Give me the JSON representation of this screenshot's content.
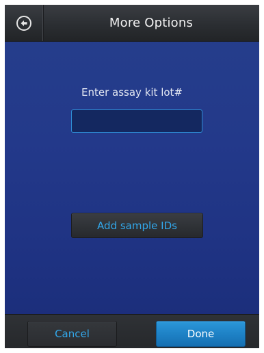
{
  "header": {
    "title": "More Options",
    "back_icon": "back-arrow-circle-icon"
  },
  "form": {
    "lot_label": "Enter assay kit lot#",
    "lot_value": "",
    "lot_placeholder": ""
  },
  "actions": {
    "add_sample_ids_label": "Add sample IDs"
  },
  "footer": {
    "cancel_label": "Cancel",
    "done_label": "Done"
  },
  "colors": {
    "background": "#23398a",
    "titlebar": "#2b2e32",
    "accent_text": "#32a8ec",
    "done_button": "#1d80c4",
    "input_border": "#2e8fd6"
  }
}
